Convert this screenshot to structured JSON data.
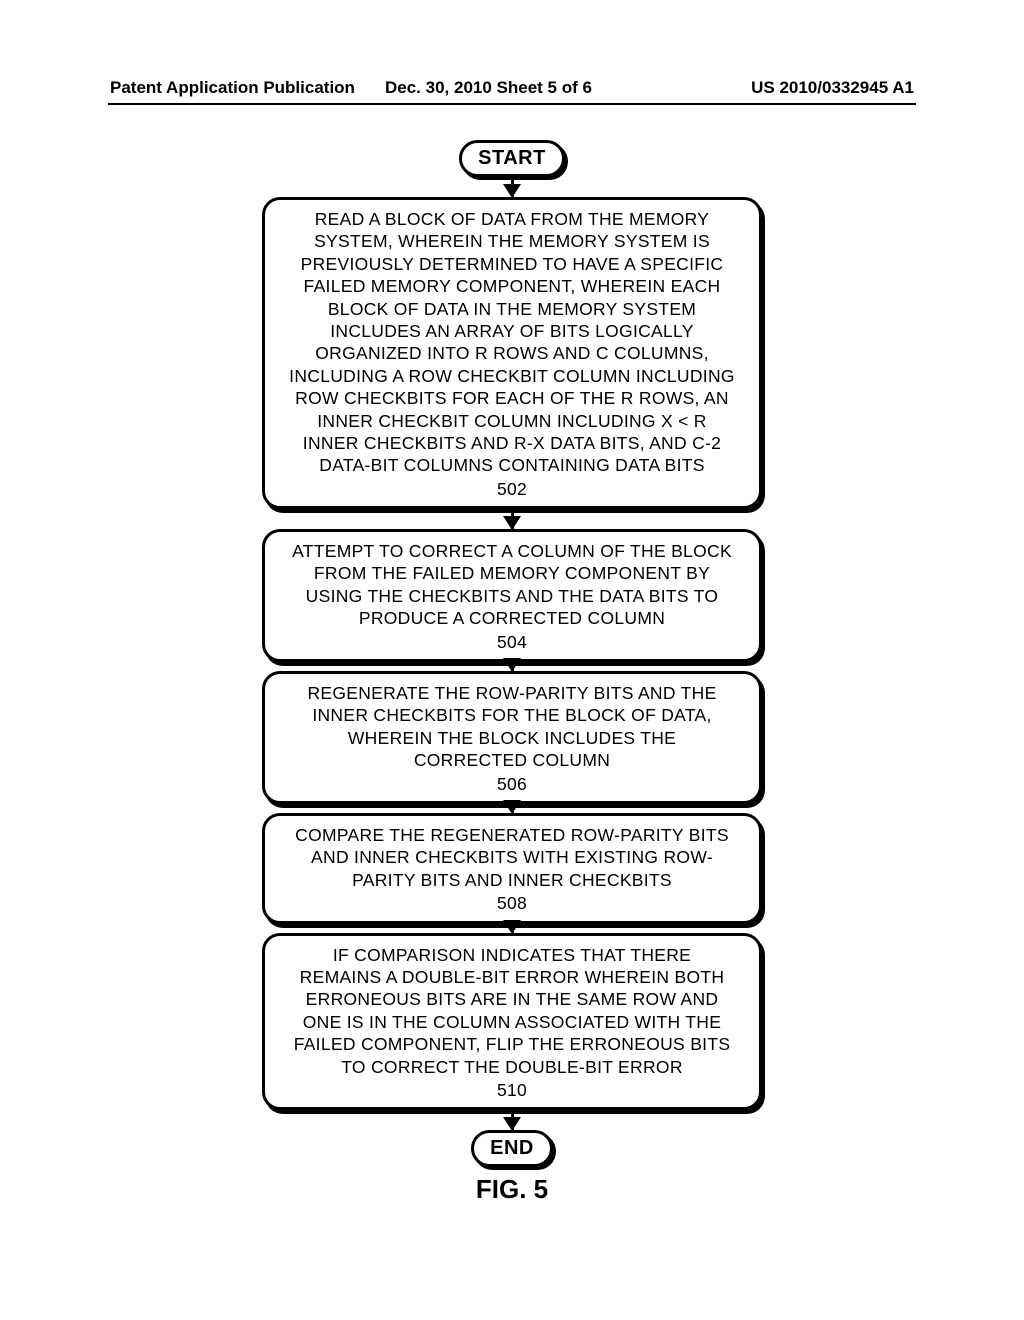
{
  "header": {
    "left": "Patent Application Publication",
    "center": "Dec. 30, 2010  Sheet 5 of 6",
    "right": "US 2010/0332945 A1"
  },
  "flowchart": {
    "start": "START",
    "end": "END",
    "steps": [
      {
        "text": "READ A BLOCK OF DATA FROM THE MEMORY\nSYSTEM, WHEREIN THE MEMORY SYSTEM IS\nPREVIOUSLY DETERMINED TO HAVE A SPECIFIC\nFAILED MEMORY COMPONENT, WHEREIN EACH\nBLOCK OF DATA IN THE MEMORY SYSTEM\nINCLUDES AN ARRAY OF BITS LOGICALLY\nORGANIZED INTO R ROWS AND C COLUMNS,\nINCLUDING A ROW CHECKBIT COLUMN INCLUDING\nROW CHECKBITS FOR EACH OF THE R ROWS, AN\nINNER CHECKBIT COLUMN INCLUDING X < R\nINNER CHECKBITS AND R-X DATA BITS, AND C-2\nDATA-BIT COLUMNS CONTAINING DATA BITS",
        "num": "502"
      },
      {
        "text": "ATTEMPT TO CORRECT A COLUMN OF THE BLOCK\nFROM THE FAILED MEMORY COMPONENT BY\nUSING THE CHECKBITS AND THE DATA BITS TO\nPRODUCE A CORRECTED COLUMN",
        "num": "504"
      },
      {
        "text": "REGENERATE THE ROW-PARITY BITS AND THE\nINNER CHECKBITS FOR THE BLOCK OF DATA,\nWHEREIN THE BLOCK INCLUDES THE\nCORRECTED COLUMN",
        "num": "506"
      },
      {
        "text": "COMPARE THE REGENERATED ROW-PARITY BITS\nAND INNER CHECKBITS WITH EXISTING ROW-\nPARITY BITS AND INNER CHECKBITS",
        "num": "508"
      },
      {
        "text": "IF COMPARISON INDICATES THAT THERE\nREMAINS A DOUBLE-BIT ERROR WHEREIN BOTH\nERRONEOUS BITS ARE IN THE SAME ROW AND\nONE IS IN THE COLUMN ASSOCIATED WITH THE\nFAILED COMPONENT, FLIP THE ERRONEOUS BITS\nTO CORRECT THE DOUBLE-BIT ERROR",
        "num": "510"
      }
    ]
  },
  "figure_label": "FIG. 5"
}
